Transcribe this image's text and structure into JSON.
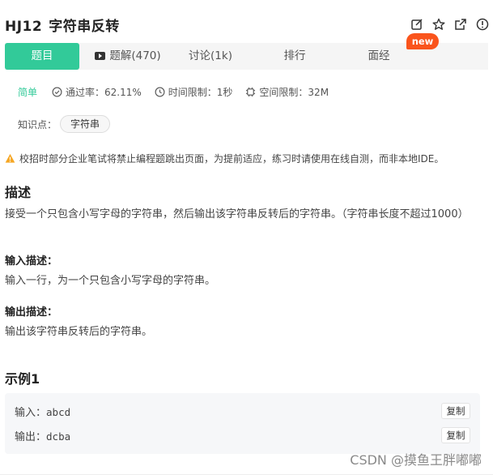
{
  "header": {
    "problem_id": "HJ12",
    "problem_title": "字符串反转",
    "icons": [
      "edit-icon",
      "star-icon",
      "external-link-icon",
      "info-icon"
    ]
  },
  "tabs": [
    {
      "label": "题目",
      "active": true
    },
    {
      "label": "题解(470)",
      "active": false,
      "icon": "video-icon"
    },
    {
      "label": "讨论(1k)",
      "active": false
    },
    {
      "label": "排行",
      "active": false
    },
    {
      "label": "面经",
      "active": false
    }
  ],
  "new_badge": "new",
  "meta": {
    "difficulty": "简单",
    "pass_rate": "通过率：62.11%",
    "time_limit": "时间限制：1秒",
    "space_limit": "空间限制：32M"
  },
  "knowledge": {
    "label": "知识点：",
    "tag": "字符串"
  },
  "warning": "校招时部分企业笔试将禁止编程题跳出页面，为提前适应，练习时请使用在线自测，而非本地IDE。",
  "description": {
    "heading": "描述",
    "text": "接受一个只包含小写字母的字符串，然后输出该字符串反转后的字符串。（字符串长度不超过1000）"
  },
  "input_desc": {
    "heading": "输入描述：",
    "text": "输入一行，为一个只包含小写字母的字符串。"
  },
  "output_desc": {
    "heading": "输出描述：",
    "text": "输出该字符串反转后的字符串。"
  },
  "example": {
    "heading": "示例1",
    "input_label": "输入：",
    "input_value": "abcd",
    "output_label": "输出：",
    "output_value": "dcba",
    "copy_label": "复制"
  },
  "watermark": "CSDN @摸鱼王胖嘟嘟",
  "colors": {
    "accent": "#32ca99",
    "new_badge": "#fa541c",
    "warning": "#f5a623"
  }
}
